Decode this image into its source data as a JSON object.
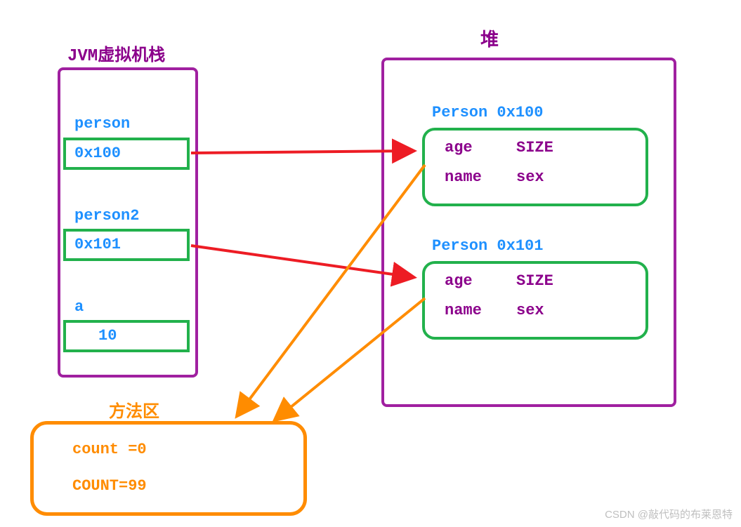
{
  "stack": {
    "title": "JVM虚拟机栈",
    "entries": [
      {
        "label": "person",
        "value": "0x100"
      },
      {
        "label": "person2",
        "value": "0x101"
      },
      {
        "label": "a",
        "value": "10"
      }
    ]
  },
  "heap": {
    "title": "堆",
    "objects": [
      {
        "header": "Person 0x100",
        "fields": {
          "f1": "age",
          "f2": "SIZE",
          "f3": "name",
          "f4": "sex"
        }
      },
      {
        "header": "Person 0x101",
        "fields": {
          "f1": "age",
          "f2": "SIZE",
          "f3": "name",
          "f4": "sex"
        }
      }
    ]
  },
  "methodArea": {
    "title": "方法区",
    "lines": {
      "l1": "count =0",
      "l2": "COUNT=99"
    }
  },
  "watermark": "CSDN @敲代码的布莱恩特"
}
